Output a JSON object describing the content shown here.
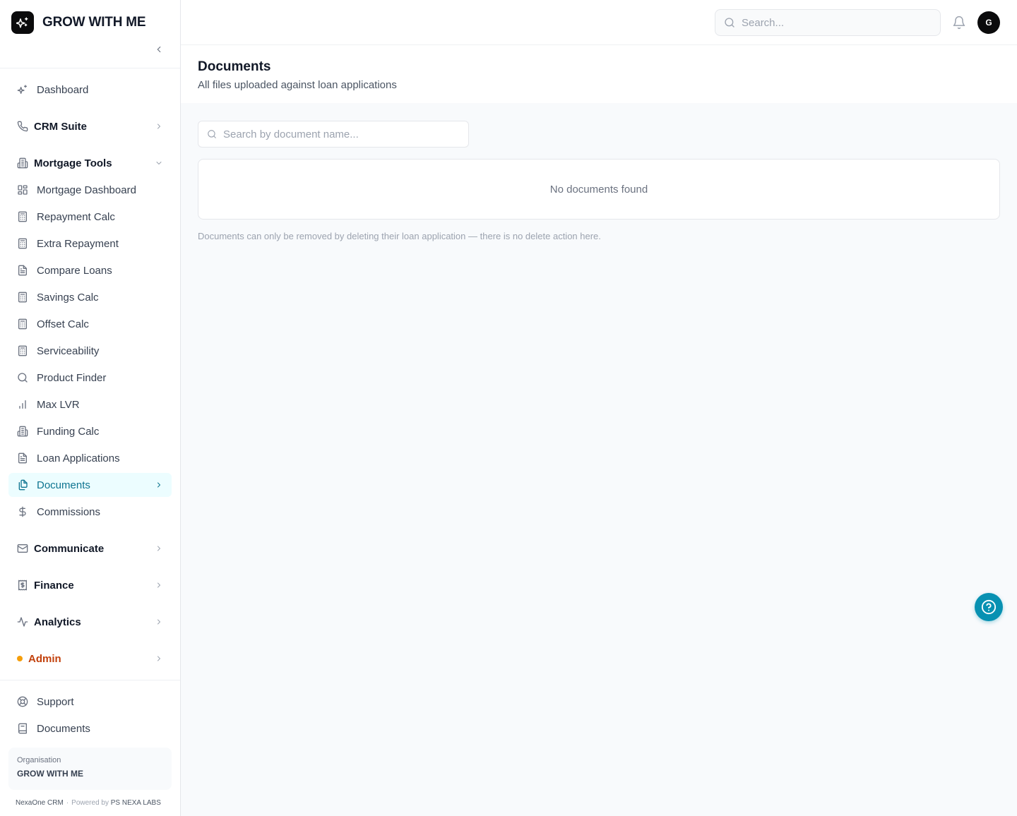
{
  "brand": {
    "name": "GROW WITH ME"
  },
  "topbar": {
    "search_placeholder": "Search...",
    "avatar_initial": "G"
  },
  "sidebar": {
    "dashboard": "Dashboard",
    "crm_suite": "CRM Suite",
    "mortgage_tools": "Mortgage Tools",
    "mortgage_items": [
      "Mortgage Dashboard",
      "Repayment Calc",
      "Extra Repayment",
      "Compare Loans",
      "Savings Calc",
      "Offset Calc",
      "Serviceability",
      "Product Finder",
      "Max LVR",
      "Funding Calc",
      "Loan Applications",
      "Documents",
      "Commissions"
    ],
    "communicate": "Communicate",
    "finance": "Finance",
    "analytics": "Analytics",
    "admin": "Admin",
    "support": "Support",
    "documents_link": "Documents",
    "org_label": "Organisation",
    "org_name": "GROW WITH ME",
    "footer_app": "NexaOne CRM",
    "footer_sep": "·",
    "footer_powered": "Powered by",
    "footer_company": "PS NEXA LABS"
  },
  "page": {
    "title": "Documents",
    "subtitle": "All files uploaded against loan applications",
    "search_placeholder": "Search by document name...",
    "empty_message": "No documents found",
    "note": "Documents can only be removed by deleting their loan application — there is no delete action here."
  },
  "colors": {
    "accent": "#0891b2",
    "active_bg": "#ecfdff",
    "admin": "#c2410c",
    "admin_dot": "#f59e0b"
  }
}
